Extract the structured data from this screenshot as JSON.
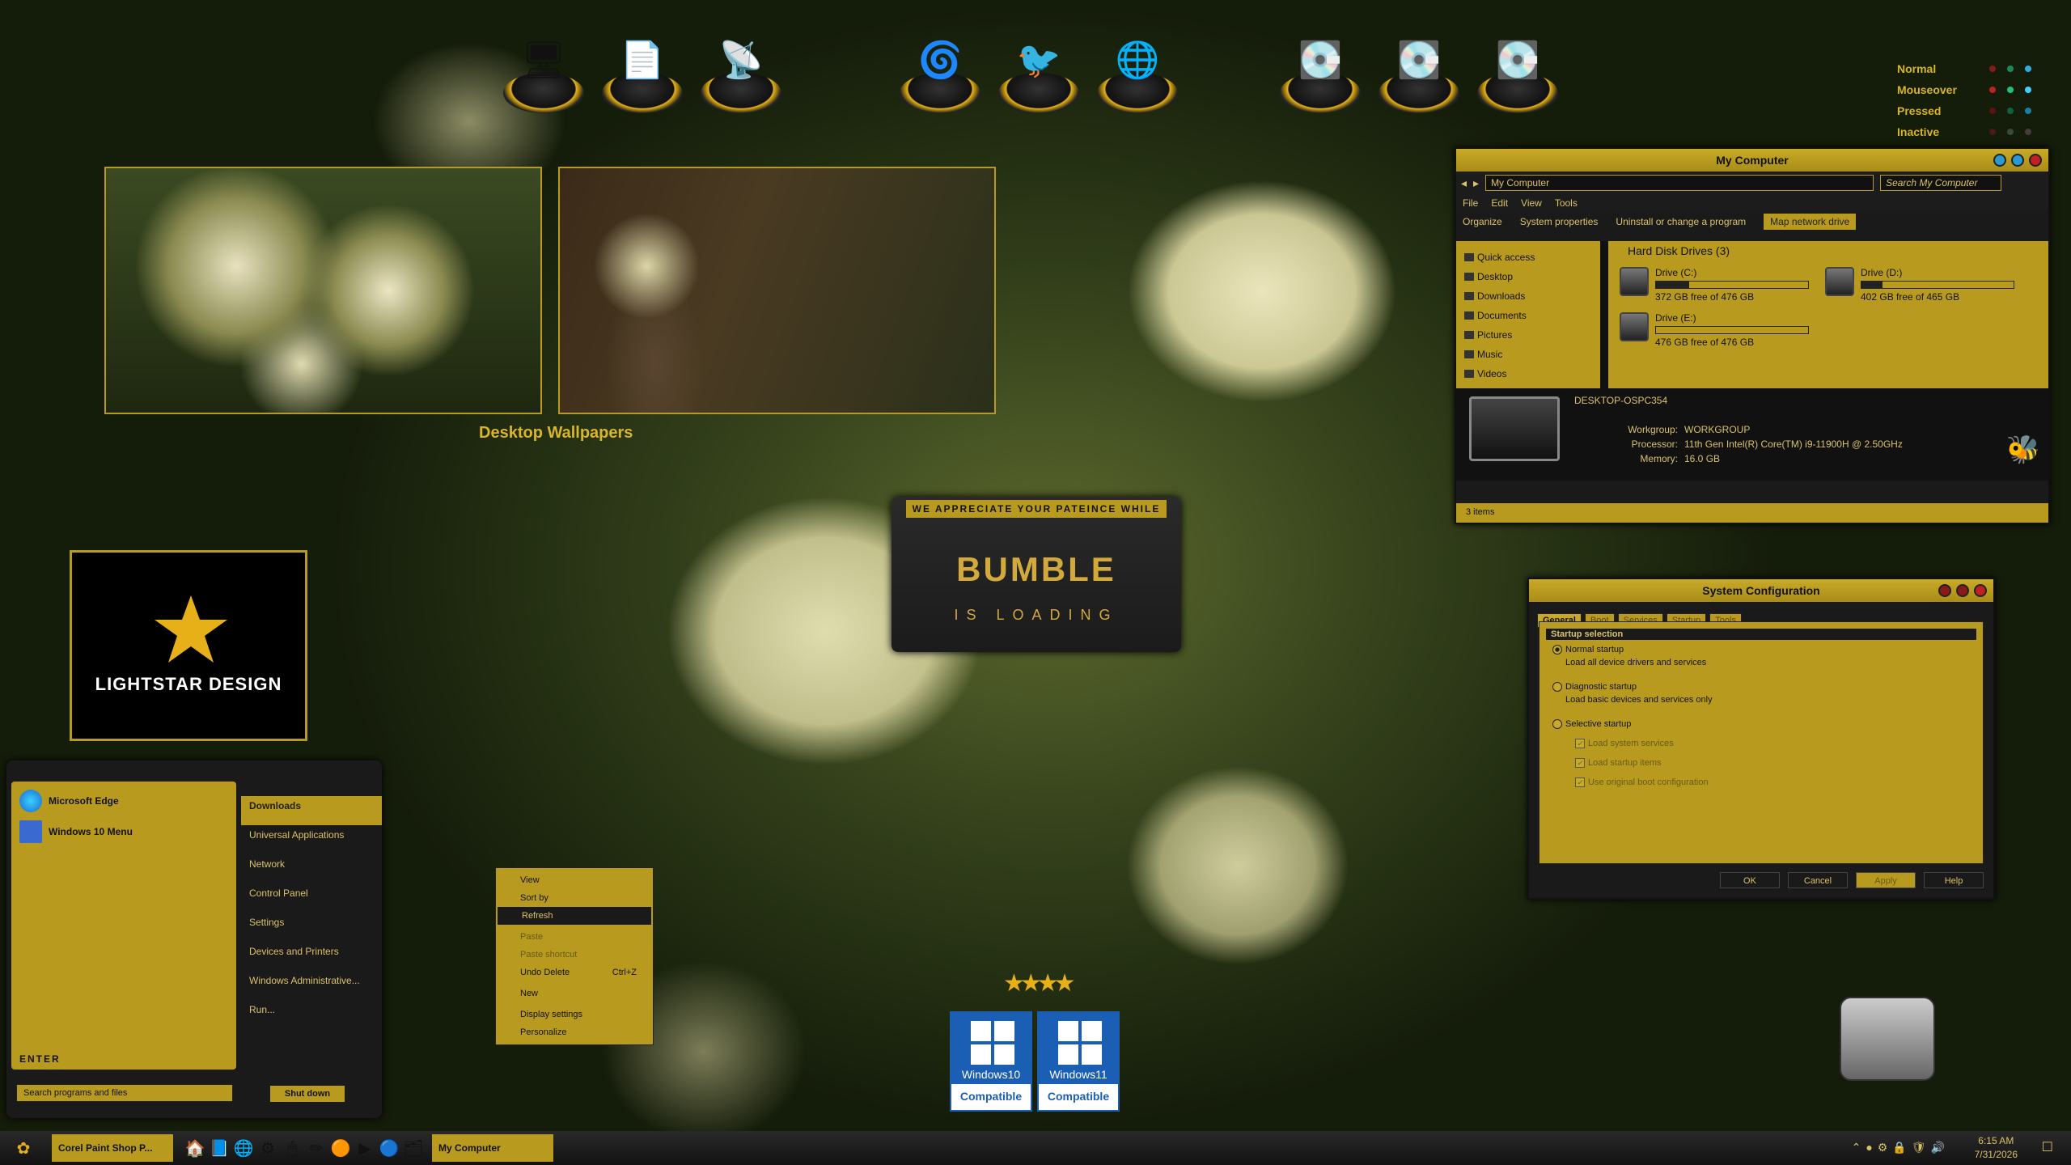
{
  "legend": {
    "states": [
      "Normal",
      "Mouseover",
      "Pressed",
      "Inactive"
    ],
    "dot_colors": [
      "#8a1a1a",
      "#1a8a5a",
      "#2ab0e0"
    ]
  },
  "wallpapers": {
    "caption": "Desktop Wallpapers"
  },
  "logo": {
    "text": "LIGHTSTAR DESIGN"
  },
  "loading": {
    "banner": "WE APPRECIATE YOUR PATEINCE WHILE",
    "title": "BUMBLE",
    "subtitle": "IS LOADING"
  },
  "mycomputer": {
    "title": "My Computer",
    "address": "My Computer",
    "search_placeholder": "Search My Computer",
    "menu": [
      "File",
      "Edit",
      "View",
      "Tools"
    ],
    "commands": [
      "Organize",
      "System properties",
      "Uninstall or change a program",
      "Map network drive"
    ],
    "nav": [
      "Quick access",
      "Desktop",
      "Downloads",
      "Documents",
      "Pictures",
      "Music",
      "Videos"
    ],
    "group": "Hard Disk Drives (3)",
    "drives": [
      {
        "name": "Drive (C:)",
        "free": "372 GB free of 476 GB",
        "used": 0.22
      },
      {
        "name": "Drive (D:)",
        "free": "402 GB free of 465 GB",
        "used": 0.14
      },
      {
        "name": "Drive (E:)",
        "free": "476 GB free of 476 GB",
        "used": 0.0
      }
    ],
    "pc_name": "DESKTOP-OSPC354",
    "workgroup_label": "Workgroup:",
    "workgroup": "WORKGROUP",
    "processor_label": "Processor:",
    "processor": "11th Gen Intel(R) Core(TM) i9-11900H @ 2.50GHz",
    "memory_label": "Memory:",
    "memory": "16.0 GB",
    "status": "3 items"
  },
  "sysconfig": {
    "title": "System Configuration",
    "tabs": [
      "General",
      "Boot",
      "Services",
      "Startup",
      "Tools"
    ],
    "section": "Startup selection",
    "normal": "Normal startup",
    "normal_desc": "Load all device drivers and services",
    "diag": "Diagnostic startup",
    "diag_desc": "Load basic devices and services only",
    "selective": "Selective startup",
    "checks": [
      "Load system services",
      "Load startup items",
      "Use original boot configuration"
    ],
    "buttons": [
      "OK",
      "Cancel",
      "Apply",
      "Help"
    ]
  },
  "startmenu": {
    "pinned": [
      "Microsoft Edge",
      "Windows 10 Menu"
    ],
    "enter": "ENTER",
    "right": [
      "Downloads",
      "Universal Applications",
      "Network",
      "Control Panel",
      "Settings",
      "Devices and Printers",
      "Windows Administrative...",
      "Run..."
    ],
    "search_placeholder": "Search programs and files",
    "shutdown": "Shut down"
  },
  "context": {
    "items": [
      "View",
      "Sort by",
      "Refresh",
      "Paste",
      "Paste shortcut",
      "Undo Delete",
      "New",
      "Display settings",
      "Personalize"
    ],
    "undo_shortcut": "Ctrl+Z"
  },
  "badges": [
    {
      "name": "Windows10",
      "compat": "Compatible"
    },
    {
      "name": "Windows11",
      "compat": "Compatible"
    }
  ],
  "taskbar": {
    "items": [
      "Corel Paint Shop P...",
      "My Computer"
    ],
    "time": "6:15 AM",
    "date": "7/31/2026"
  }
}
